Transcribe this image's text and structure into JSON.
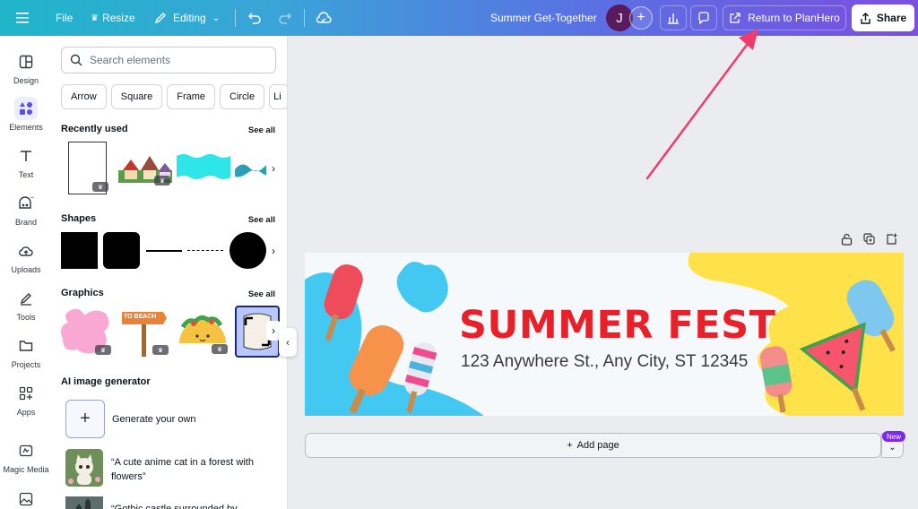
{
  "topbar": {
    "file": "File",
    "resize": "Resize",
    "editing": "Editing",
    "doc_title": "Summer Get-Together",
    "avatar_initial": "J",
    "return_label": "Return to PlanHero",
    "share_label": "Share"
  },
  "rail": {
    "items": [
      {
        "label": "Design",
        "icon": "design-icon"
      },
      {
        "label": "Elements",
        "icon": "elements-icon"
      },
      {
        "label": "Text",
        "icon": "text-icon"
      },
      {
        "label": "Brand",
        "icon": "brand-icon"
      },
      {
        "label": "Uploads",
        "icon": "uploads-icon"
      },
      {
        "label": "Tools",
        "icon": "tools-icon"
      },
      {
        "label": "Projects",
        "icon": "projects-icon"
      },
      {
        "label": "Apps",
        "icon": "apps-icon"
      },
      {
        "label": "Magic Media",
        "icon": "magic-media-icon"
      }
    ]
  },
  "panel": {
    "search_placeholder": "Search elements",
    "chips": [
      "Arrow",
      "Square",
      "Frame",
      "Circle",
      "Li"
    ],
    "recently_used": "Recently used",
    "shapes": "Shapes",
    "graphics": "Graphics",
    "see_all": "See all",
    "ai_title": "AI image generator",
    "generate": "Generate your own",
    "prompt1": "“A cute anime cat in a forest with flowers”",
    "prompt2": "“Gothic castle surrounded by"
  },
  "canvas": {
    "headline": "SUMMER FEST",
    "address": "123 Anywhere St., Any City, ST 12345",
    "add_page": "Add page",
    "new_badge": "New"
  },
  "graphics": {
    "beach_sign": "TO BEACH"
  },
  "colors": {
    "accent": "#7d2ae8",
    "headline": "#e8202a",
    "splash_blue": "#43c8f2",
    "splash_yellow": "#ffe14a",
    "arrow": "#ef3d6b"
  }
}
